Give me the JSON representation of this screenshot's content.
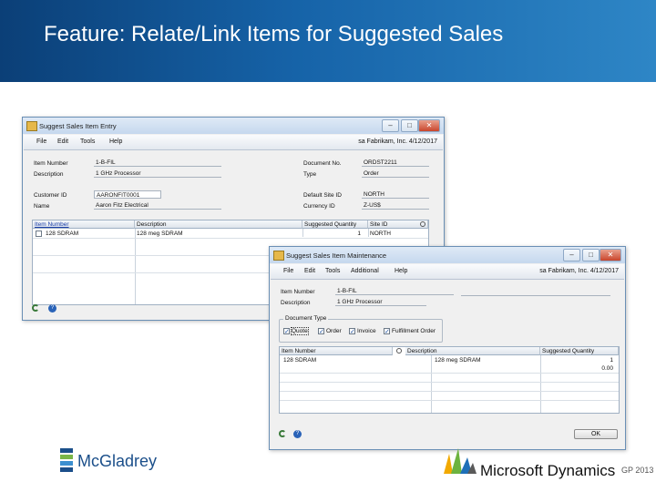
{
  "slide": {
    "title": "Feature: Relate/Link Items for Suggested Sales"
  },
  "window1": {
    "title": "Suggest Sales Item Entry",
    "menus": [
      "File",
      "Edit",
      "Tools",
      "Help"
    ],
    "context": "sa  Fabrikam, Inc.  4/12/2017",
    "left_fields": [
      {
        "label": "Item Number",
        "value": "1-B-FIL"
      },
      {
        "label": "Description",
        "value": "1 GHz Processor"
      },
      {
        "label": "Customer ID",
        "value": "AARONFIT0001"
      },
      {
        "label": "Name",
        "value": "Aaron Fitz Electrical"
      }
    ],
    "right_fields": [
      {
        "label": "Document No.",
        "value": "ORDST2211"
      },
      {
        "label": "Type",
        "value": "Order"
      },
      {
        "label": "Default Site ID",
        "value": "NORTH"
      },
      {
        "label": "Currency ID",
        "value": "Z-US$"
      }
    ],
    "grid_headers": [
      "Item Number",
      "Description",
      "Suggested Quantity",
      "Site ID"
    ],
    "rows": [
      {
        "item": "128 SDRAM",
        "description": "128 meg SDRAM",
        "qty": "1",
        "site": "NORTH"
      }
    ]
  },
  "window2": {
    "title": "Suggest Sales Item Maintenance",
    "menus": [
      "File",
      "Edit",
      "Tools",
      "Additional",
      "Help"
    ],
    "context": "sa  Fabrikam, Inc.  4/12/2017",
    "item_number_label": "Item Number",
    "item_number_value": "1-B-FIL",
    "description_label": "Description",
    "description_value": "1 GHz Processor",
    "doc_type_group": "Document Type",
    "doc_types": [
      {
        "label": "Quote",
        "checked": true
      },
      {
        "label": "Order",
        "checked": true
      },
      {
        "label": "Invoice",
        "checked": true
      },
      {
        "label": "Fulfillment Order",
        "checked": true
      }
    ],
    "grid_headers": [
      "Item Number",
      "Description",
      "Suggested Quantity"
    ],
    "rows": [
      {
        "item": "128 SDRAM",
        "description": "128 meg SDRAM",
        "qty": "1"
      },
      {
        "item": "",
        "description": "",
        "qty": "0.00"
      }
    ],
    "ok_button": "OK"
  },
  "branding": {
    "left_logo": "McGladrey",
    "right_logo": "Microsoft Dynamics",
    "right_version": "GP 2013"
  },
  "colors": {
    "header_dark": "#0b3f77",
    "header_light": "#2e86c6",
    "mcgladrey_blue": "#1b4f8a",
    "mcgladrey_green": "#7ab648"
  }
}
